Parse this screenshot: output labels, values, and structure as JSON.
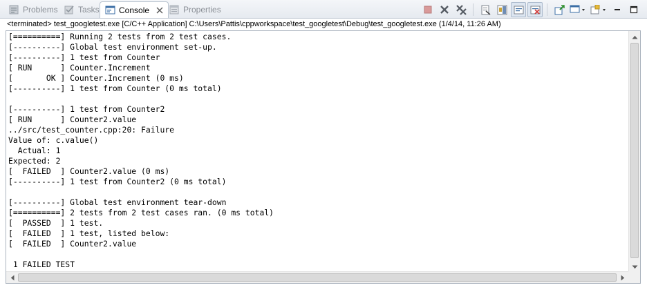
{
  "tabs": [
    {
      "label": "Problems",
      "icon": "problems-icon",
      "active": false
    },
    {
      "label": "Tasks",
      "icon": "tasks-icon",
      "active": false
    },
    {
      "label": "Console",
      "icon": "console-icon",
      "active": true
    },
    {
      "label": "Properties",
      "icon": "properties-icon",
      "active": false
    }
  ],
  "toolbar": {
    "buttons": [
      "terminate-icon",
      "remove-launch-icon",
      "remove-all-terminated-icon",
      "clear-console-icon",
      "scroll-lock-icon",
      "word-wrap-icon",
      "show-on-stdout-icon",
      "show-on-stderr-icon",
      "pin-console-icon",
      "display-console-icon",
      "open-console-icon",
      "minimize-icon",
      "maximize-icon"
    ]
  },
  "status": "<terminated> test_googletest.exe [C/C++ Application] C:\\Users\\Pattis\\cppworkspace\\test_googletest\\Debug\\test_googletest.exe (1/4/14, 11:26 AM)",
  "console_lines": [
    "[==========] Running 2 tests from 2 test cases.",
    "[----------] Global test environment set-up.",
    "[----------] 1 test from Counter",
    "[ RUN      ] Counter.Increment",
    "[       OK ] Counter.Increment (0 ms)",
    "[----------] 1 test from Counter (0 ms total)",
    "",
    "[----------] 1 test from Counter2",
    "[ RUN      ] Counter2.value",
    "../src/test_counter.cpp:20: Failure",
    "Value of: c.value()",
    "  Actual: 1",
    "Expected: 2",
    "[  FAILED  ] Counter2.value (0 ms)",
    "[----------] 1 test from Counter2 (0 ms total)",
    "",
    "[----------] Global test environment tear-down",
    "[==========] 2 tests from 2 test cases ran. (0 ms total)",
    "[  PASSED  ] 1 test.",
    "[  FAILED  ] 1 test, listed below:",
    "[  FAILED  ] Counter2.value",
    "",
    " 1 FAILED TEST"
  ],
  "colors": {
    "tab_active_bg": "#ffffff",
    "tab_inactive_text": "#8a8f96",
    "console_text": "#000000"
  }
}
